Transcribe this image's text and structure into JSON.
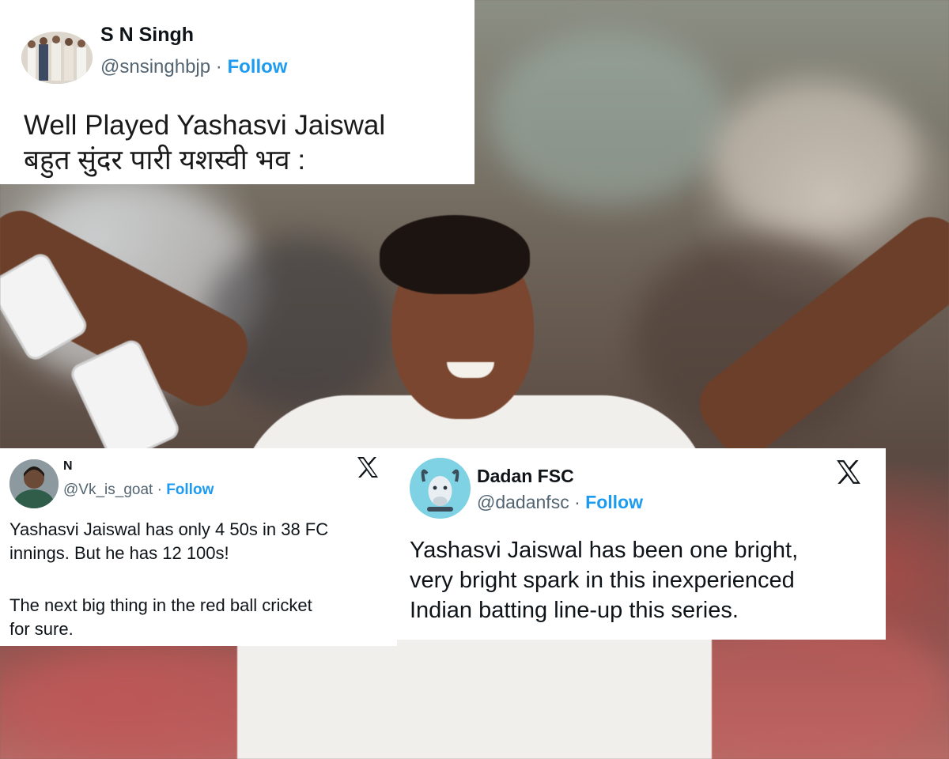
{
  "tweets": [
    {
      "display_name": "S N Singh",
      "handle": "@snsinghbjp",
      "separator": "·",
      "follow_label": "Follow",
      "text_lines": [
        "Well Played Yashasvi Jaiswal",
        "बहुत सुंदर पारी यशस्वी भव :"
      ]
    },
    {
      "display_name": "N",
      "handle": "@Vk_is_goat",
      "separator": "·",
      "follow_label": "Follow",
      "text_lines": [
        "Yashasvi Jaiswal has only 4 50s in 38 FC",
        "innings. But he has 12 100s!",
        "",
        "The next big thing in the red ball cricket",
        "for sure."
      ],
      "platform_icon": "x-logo-icon"
    },
    {
      "display_name": "Dadan FSC",
      "handle": "@dadanfsc",
      "separator": "·",
      "follow_label": "Follow",
      "text_lines": [
        "Yashasvi Jaiswal has been one bright,",
        "very bright spark in this inexperienced",
        "Indian batting line-up this series."
      ],
      "platform_icon": "x-logo-icon"
    }
  ],
  "colors": {
    "follow": "#1d9bf0",
    "text": "#0f1419",
    "muted": "#536471",
    "card_bg": "#ffffff"
  }
}
